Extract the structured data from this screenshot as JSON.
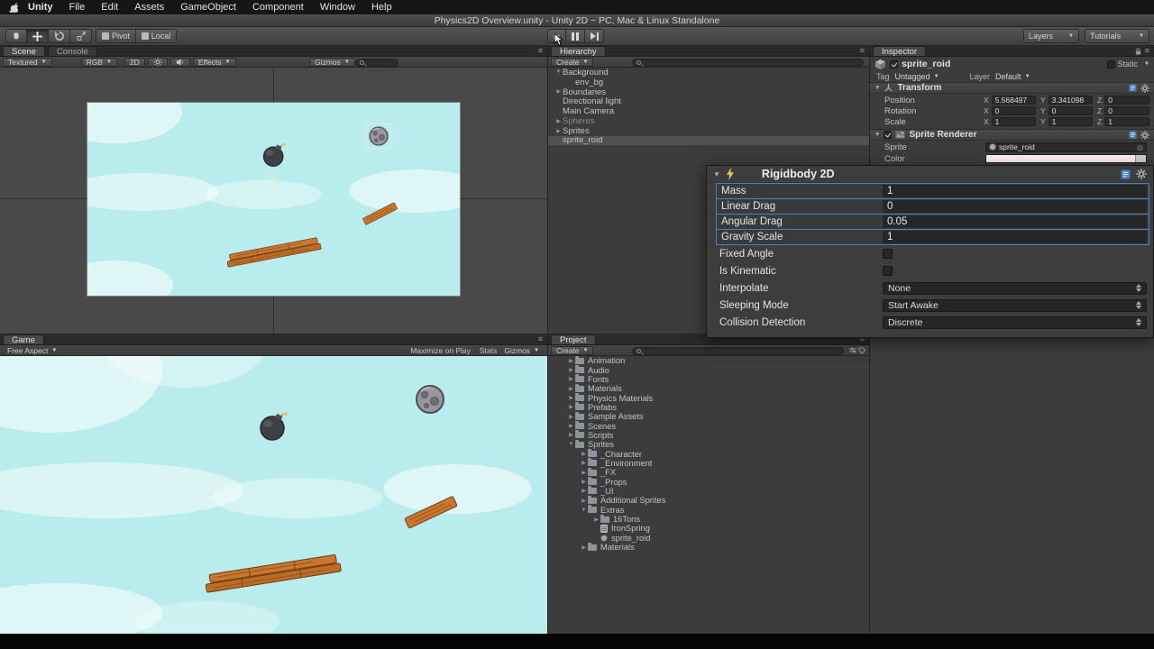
{
  "menubar": {
    "items": [
      "Unity",
      "File",
      "Edit",
      "Assets",
      "GameObject",
      "Component",
      "Window",
      "Help"
    ]
  },
  "titlebar": {
    "title": "Physics2D Overview.unity - Unity 2D ~ PC, Mac & Linux Standalone"
  },
  "toolbar": {
    "pivot": "Pivot",
    "local": "Local",
    "layers": "Layers",
    "tutorials": "Tutorials"
  },
  "scene": {
    "tab": "Scene",
    "console_tab": "Console",
    "shading": "Textured",
    "color_mode": "RGB",
    "mode2d": "2D",
    "effects": "Effects",
    "gizmos": "Gizmos"
  },
  "game": {
    "tab": "Game",
    "aspect": "Free Aspect",
    "maximize_on_play": "Maximize on Play",
    "stats": "Stats",
    "gizmos": "Gizmos"
  },
  "hierarchy": {
    "tab": "Hierarchy",
    "create": "Create",
    "items": [
      {
        "label": "Background",
        "arrow": "▼"
      },
      {
        "label": "env_bg",
        "arrow": ""
      },
      {
        "label": "Boundaries",
        "arrow": "▶"
      },
      {
        "label": "Directional light",
        "arrow": ""
      },
      {
        "label": "Main Camera",
        "arrow": ""
      },
      {
        "label": "Spheres",
        "arrow": "▶"
      },
      {
        "label": "Sprites",
        "arrow": "▶"
      },
      {
        "label": "sprite_roid",
        "arrow": ""
      }
    ]
  },
  "project": {
    "tab": "Project",
    "create": "Create",
    "items": [
      {
        "label": "Animation",
        "arrow": "▶"
      },
      {
        "label": "Audio",
        "arrow": "▶"
      },
      {
        "label": "Fonts",
        "arrow": "▶"
      },
      {
        "label": "Materials",
        "arrow": "▶"
      },
      {
        "label": "Physics Materials",
        "arrow": "▶"
      },
      {
        "label": "Prefabs",
        "arrow": "▶"
      },
      {
        "label": "Sample Assets",
        "arrow": "▶"
      },
      {
        "label": "Scenes",
        "arrow": "▶"
      },
      {
        "label": "Scripts",
        "arrow": "▶"
      },
      {
        "label": "Sprites",
        "arrow": "▼"
      },
      {
        "label": "_Character",
        "arrow": "▶"
      },
      {
        "label": "_Environment",
        "arrow": "▶"
      },
      {
        "label": "_FX",
        "arrow": "▶"
      },
      {
        "label": "_Props",
        "arrow": "▶"
      },
      {
        "label": "_UI",
        "arrow": "▶"
      },
      {
        "label": "Additional Sprites",
        "arrow": "▶"
      },
      {
        "label": "Extras",
        "arrow": "▼"
      },
      {
        "label": "16Tons",
        "arrow": "▶"
      },
      {
        "label": "IronSpring",
        "arrow": ""
      },
      {
        "label": "sprite_roid",
        "arrow": ""
      },
      {
        "label": "Materials",
        "arrow": "▶"
      }
    ]
  },
  "inspector": {
    "tab": "Inspector",
    "object_name": "sprite_roid",
    "static_label": "Static",
    "tag_label": "Tag",
    "tag_value": "Untagged",
    "layer_label": "Layer",
    "layer_value": "Default",
    "axis": {
      "x": "X",
      "y": "Y",
      "z": "Z"
    },
    "transform": {
      "title": "Transform",
      "rows": [
        {
          "label": "Position",
          "x": "5.568497",
          "y": "3.341098",
          "z": "0"
        },
        {
          "label": "Rotation",
          "x": "0",
          "y": "0",
          "z": "0"
        },
        {
          "label": "Scale",
          "x": "1",
          "y": "1",
          "z": "1"
        }
      ]
    },
    "sprite_renderer": {
      "title": "Sprite Renderer",
      "sprite_label": "Sprite",
      "sprite_value": "sprite_roid",
      "color_label": "Color"
    }
  },
  "rigidbody": {
    "title": "Rigidbody 2D",
    "number_fields": [
      {
        "label": "Mass",
        "value": "1"
      },
      {
        "label": "Linear Drag",
        "value": "0"
      },
      {
        "label": "Angular Drag",
        "value": "0.05"
      },
      {
        "label": "Gravity Scale",
        "value": "1"
      }
    ],
    "checkbox_fields": [
      {
        "label": "Fixed Angle",
        "checked": false
      },
      {
        "label": "Is Kinematic",
        "checked": false
      }
    ],
    "dropdown_fields": [
      {
        "label": "Interpolate",
        "value": "None"
      },
      {
        "label": "Sleeping Mode",
        "value": "Start Awake"
      },
      {
        "label": "Collision Detection",
        "value": "Discrete"
      }
    ]
  },
  "colors": {
    "sky": "#b9ecec",
    "highlight_border": "#4a7fc1",
    "panel": "#3c3c3c",
    "selection": "#515151"
  }
}
